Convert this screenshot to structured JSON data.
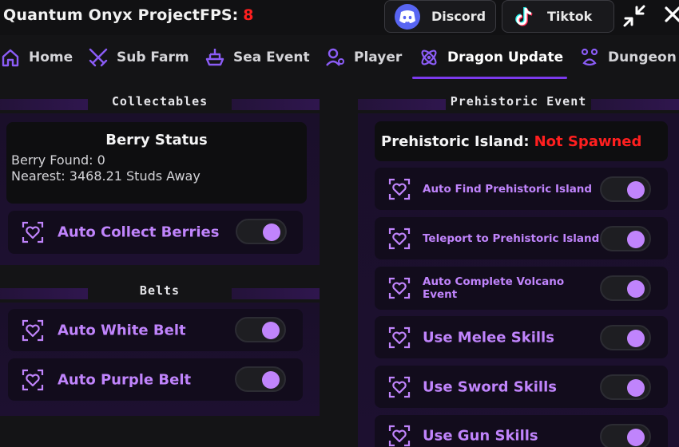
{
  "header": {
    "title": "Quantum Onyx Project",
    "fps_label": "FPS:",
    "fps_value": "8",
    "discord_label": "Discord",
    "tiktok_label": "Tiktok",
    "icons": [
      "discord-icon",
      "tiktok-icon",
      "minimize-icon",
      "close-icon"
    ]
  },
  "nav": {
    "tabs": [
      {
        "label": "Home",
        "icon": "home-icon"
      },
      {
        "label": "Sub Farm",
        "icon": "swords-icon"
      },
      {
        "label": "Sea Event",
        "icon": "ship-icon"
      },
      {
        "label": "Player",
        "icon": "user-icon"
      },
      {
        "label": "Dragon Update",
        "icon": "atom-icon",
        "active": true
      },
      {
        "label": "Dungeon",
        "icon": "paw-icon"
      }
    ]
  },
  "collectables": {
    "title": "Collectables",
    "status_title": "Berry Status",
    "berry_found": "Berry Found: 0",
    "nearest": "Nearest: 3468.21 Studs Away",
    "auto_collect": "Auto Collect Berries"
  },
  "belts": {
    "title": "Belts",
    "items": [
      "Auto White Belt",
      "Auto Purple Belt"
    ]
  },
  "prehistoric": {
    "title": "Prehistoric Event",
    "island_label": "Prehistoric Island:",
    "island_status": "Not Spawned",
    "items": [
      "Auto Find Prehistoric Island",
      "Teleport to Prehistoric Island",
      "Auto Complete Volcano Event",
      "Use Melee Skills",
      "Use Sword Skills",
      "Use Gun Skills"
    ]
  },
  "colors": {
    "accent": "#c084fc",
    "underline": "#7c3aed",
    "warning": "#ff1f1f",
    "background": "#141416"
  }
}
